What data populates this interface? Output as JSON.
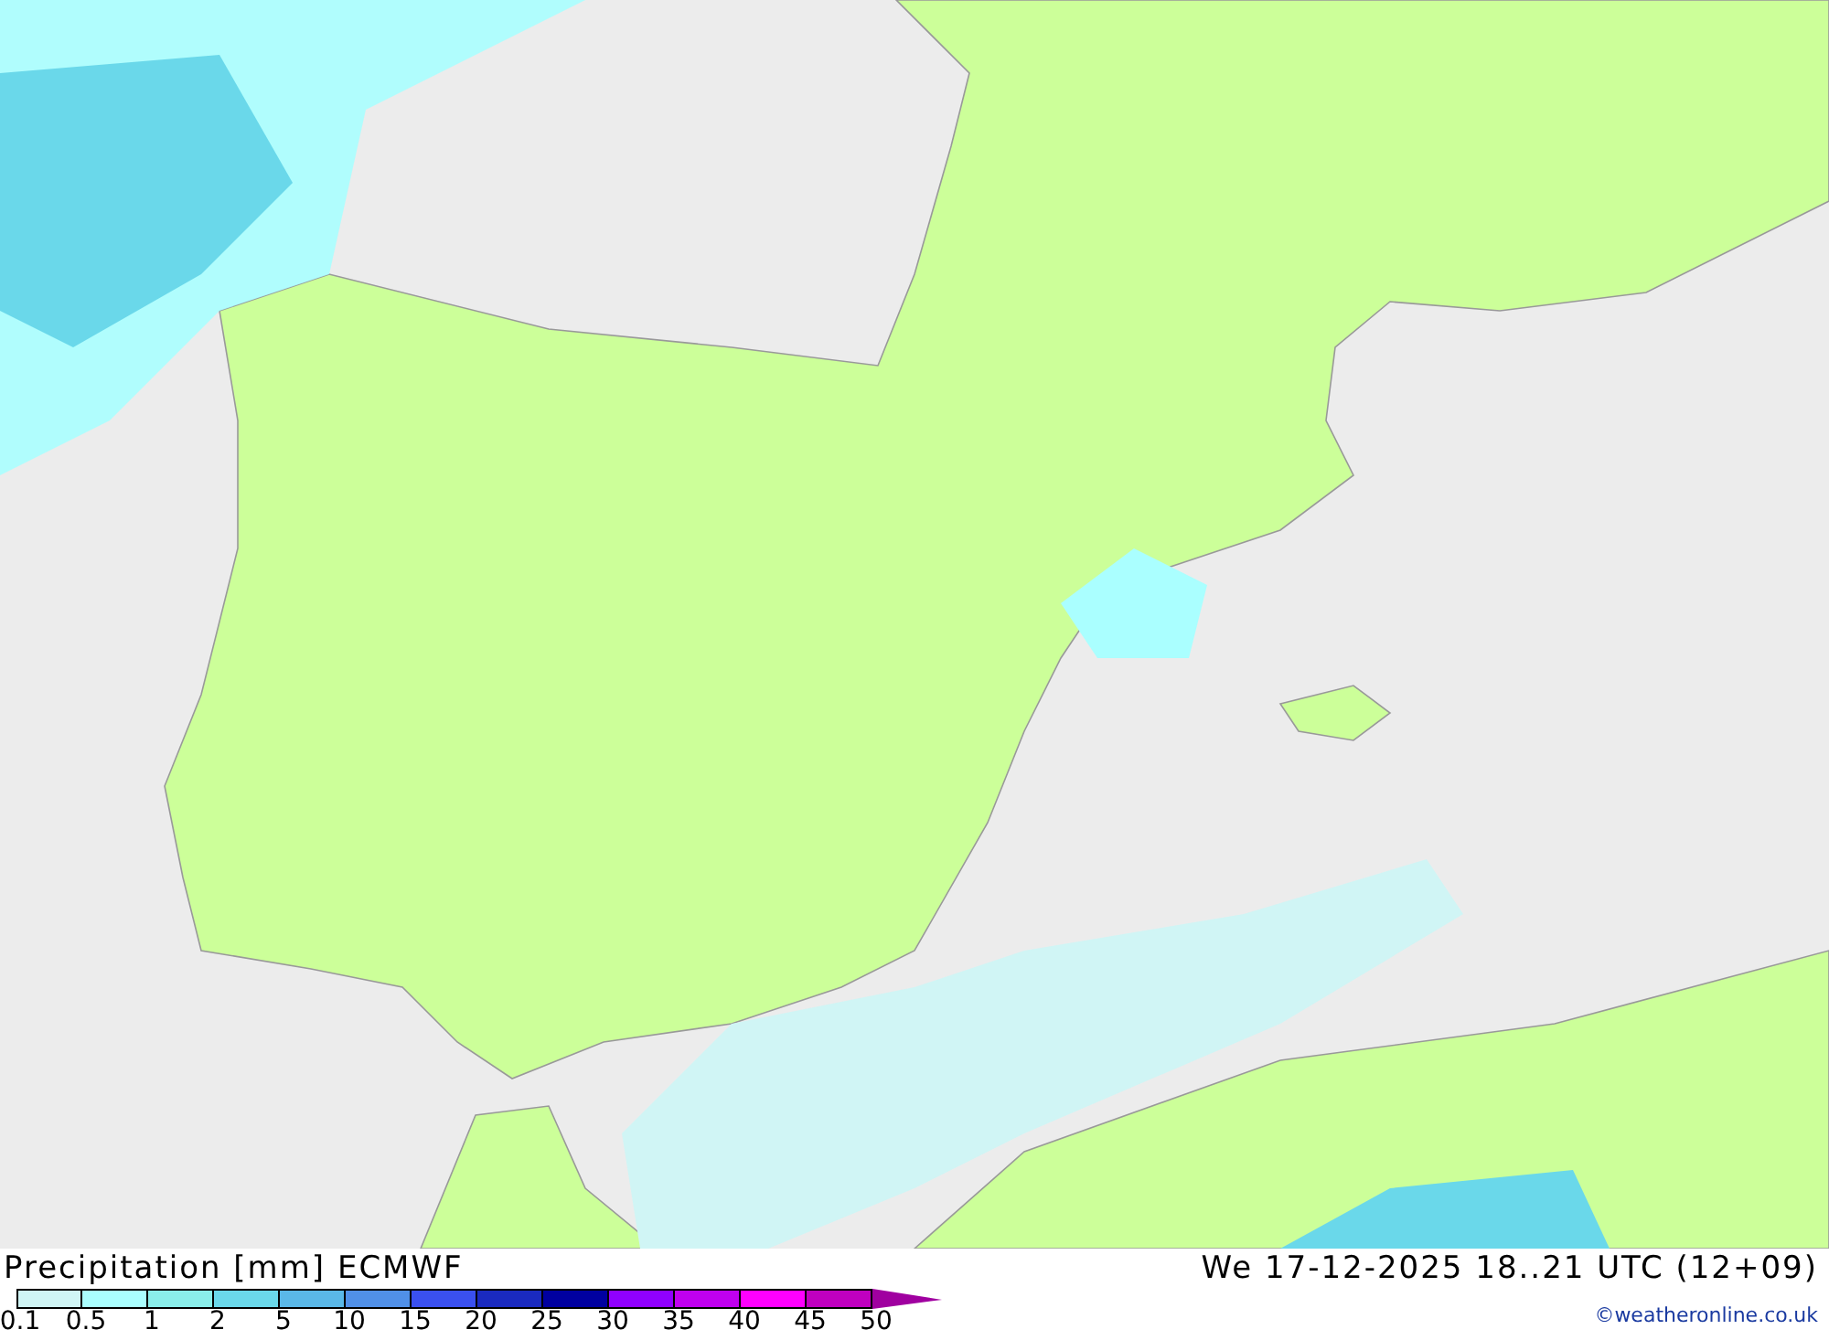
{
  "legend": {
    "title": "Precipitation [mm] ECMWF",
    "valid_time": "We 17-12-2025 18..21 UTC (12+09)",
    "credit": "©weatheronline.co.uk",
    "scale": [
      {
        "color": "#d0f5f5"
      },
      {
        "color": "#aaffff"
      },
      {
        "color": "#8aeeea"
      },
      {
        "color": "#6ad8ea"
      },
      {
        "color": "#5ab8e8"
      },
      {
        "color": "#5090e8"
      },
      {
        "color": "#3a50f0"
      },
      {
        "color": "#1a2ac0"
      },
      {
        "color": "#0000a0"
      },
      {
        "color": "#9000ff"
      },
      {
        "color": "#c000f0"
      },
      {
        "color": "#ff00ff"
      },
      {
        "color": "#c000c0"
      },
      {
        "kind": "arrow",
        "color": "#a000a0"
      }
    ],
    "labels": [
      "0.1",
      "0.5",
      "1",
      "2",
      "5",
      "10",
      "15",
      "20",
      "25",
      "30",
      "35",
      "40",
      "45",
      "50"
    ]
  }
}
